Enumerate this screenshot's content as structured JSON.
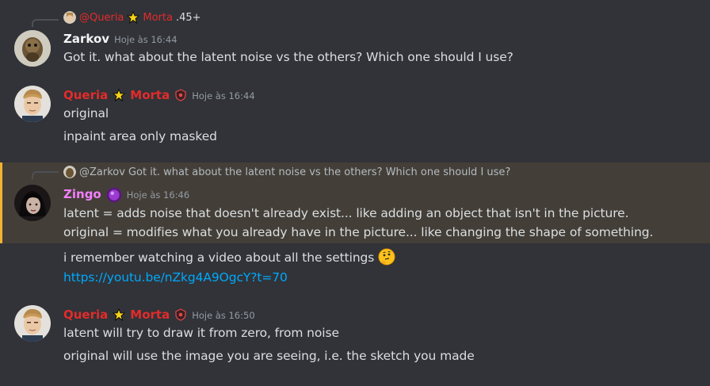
{
  "messages": [
    {
      "reply": {
        "mention": "@Queria",
        "mention2": "Morta",
        "preview": ".45+"
      },
      "author": "Zarkov",
      "timestamp": "Hoje às 16:44",
      "lines": [
        "Got it. what about the latent noise vs the others? Which one should I use?"
      ]
    },
    {
      "author_first": "Queria",
      "author_second": "Morta",
      "timestamp": "Hoje às 16:44",
      "lines": [
        "original",
        "inpaint area only masked"
      ]
    },
    {
      "reply": {
        "mention": "@Zarkov",
        "preview": "Got it. what about the latent noise vs the others? Which one should I use?"
      },
      "author": "Zingo",
      "timestamp": "Hoje às 16:46",
      "lines": [
        "latent = adds noise that doesn't already exist... like adding an object that isn't in the picture.",
        "original = modifies what you already have in the picture... like changing the shape of something.",
        "i remember watching a video about all the settings",
        "https://youtu.be/nZkg4A9OgcY?t=70"
      ]
    },
    {
      "author_first": "Queria",
      "author_second": "Morta",
      "timestamp": "Hoje às 16:50",
      "lines": [
        "latent will try to draw it from zero, from noise",
        "original will use the image you are seeing, i.e. the sketch you made"
      ]
    }
  ],
  "colors": {
    "background": "#313338",
    "highlight_bg": "#433f38",
    "highlight_border": "#f0b232",
    "queria_name": "#e32b2b",
    "zingo_name": "#f47fff",
    "zarkov_name": "#f2f3f5",
    "link": "#00a8fc",
    "timestamp": "#949ba4"
  },
  "icons": [
    "star-icon",
    "role-shield-icon",
    "thinking-emoji",
    "avatar-zarkov",
    "avatar-queria",
    "avatar-zingo"
  ]
}
